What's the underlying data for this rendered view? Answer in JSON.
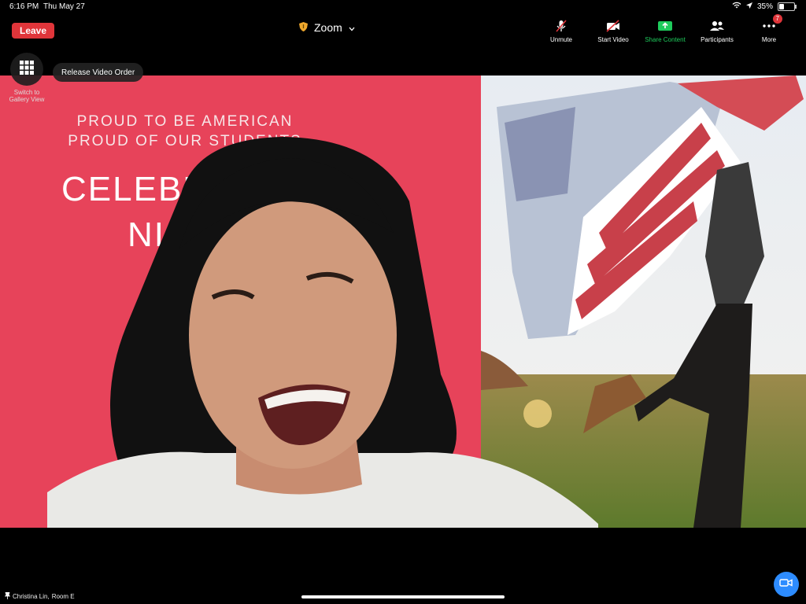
{
  "status": {
    "time": "6:16 PM",
    "date": "Thu May 27",
    "battery": "35%",
    "battery_level": 0.35
  },
  "header": {
    "leave_label": "Leave",
    "title": "Zoom"
  },
  "toolbar": {
    "unmute": "Unmute",
    "start_video": "Start Video",
    "share": "Share Content",
    "participants": "Participants",
    "more": "More",
    "more_badge": "7"
  },
  "overlay": {
    "gallery_label": "Switch to Gallery View",
    "release_label": "Release Video Order"
  },
  "slide": {
    "line1": "PROUD TO BE AMERICAN",
    "line2": "PROUD OF OUR STUDENTS",
    "big1": "CELEBR",
    "big2": "NI"
  },
  "footer": {
    "participant_name": "Christina Lin,",
    "room": "Room E"
  },
  "colors": {
    "leave": "#e0353a",
    "share": "#1ecb5c",
    "accent": "#2d8cff",
    "slide_bg": "#e7435a"
  }
}
